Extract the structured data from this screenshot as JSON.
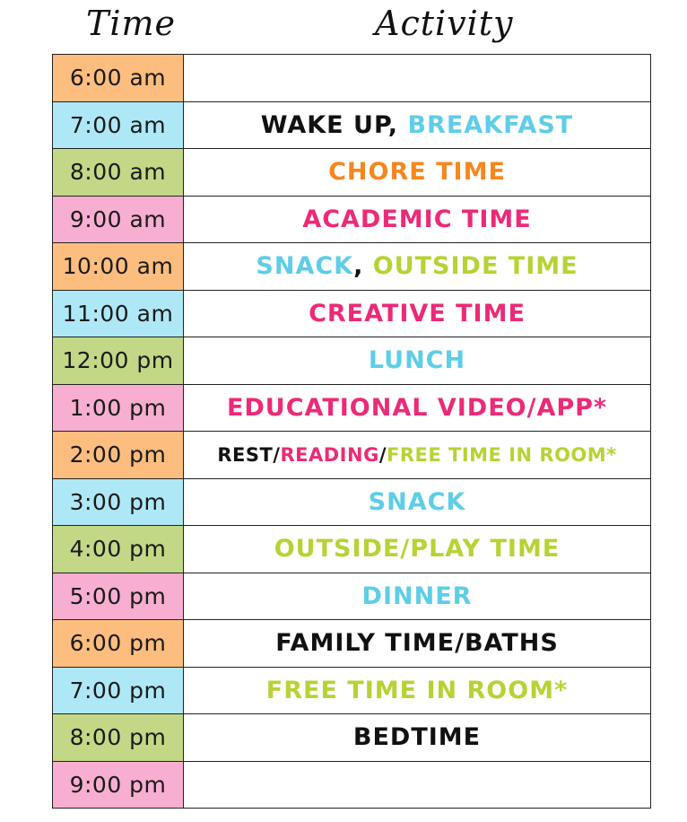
{
  "headers": {
    "time": "Time",
    "activity": "Activity"
  },
  "rows": [
    {
      "time": "6:00 am",
      "segments": []
    },
    {
      "time": "7:00 am",
      "segments": [
        {
          "text": "WAKE UP, ",
          "color": "#111111"
        },
        {
          "text": "BREAKFAST",
          "color": "#5ecde8"
        }
      ]
    },
    {
      "time": "8:00 am",
      "segments": [
        {
          "text": "CHORE TIME",
          "color": "#f6871f"
        }
      ]
    },
    {
      "time": "9:00 am",
      "segments": [
        {
          "text": "ACADEMIC TIME",
          "color": "#ec2a77"
        }
      ]
    },
    {
      "time": "10:00 am",
      "segments": [
        {
          "text": "SNACK",
          "color": "#5ecde8"
        },
        {
          "text": ", ",
          "color": "#111111"
        },
        {
          "text": "OUTSIDE TIME",
          "color": "#b5d334"
        }
      ]
    },
    {
      "time": "11:00 am",
      "segments": [
        {
          "text": "CREATIVE TIME",
          "color": "#ec2a77"
        }
      ]
    },
    {
      "time": "12:00 pm",
      "segments": [
        {
          "text": "LUNCH",
          "color": "#5ecde8"
        }
      ]
    },
    {
      "time": "1:00 pm",
      "segments": [
        {
          "text": "EDUCATIONAL VIDEO/APP*",
          "color": "#ec2a77"
        }
      ]
    },
    {
      "time": "2:00 pm",
      "small": true,
      "segments": [
        {
          "text": "REST/",
          "color": "#111111"
        },
        {
          "text": "READING",
          "color": "#ec2a77"
        },
        {
          "text": "/",
          "color": "#111111"
        },
        {
          "text": "FREE TIME IN ROOM*",
          "color": "#b5d334"
        }
      ]
    },
    {
      "time": "3:00 pm",
      "segments": [
        {
          "text": "SNACK",
          "color": "#5ecde8"
        }
      ]
    },
    {
      "time": "4:00 pm",
      "segments": [
        {
          "text": "OUTSIDE/PLAY TIME",
          "color": "#b5d334"
        }
      ]
    },
    {
      "time": "5:00 pm",
      "segments": [
        {
          "text": "DINNER",
          "color": "#5ecde8"
        }
      ]
    },
    {
      "time": "6:00 pm",
      "segments": [
        {
          "text": "FAMILY TIME/BATHS",
          "color": "#111111"
        }
      ]
    },
    {
      "time": "7:00 pm",
      "segments": [
        {
          "text": "FREE TIME IN ROOM*",
          "color": "#b5d334"
        }
      ]
    },
    {
      "time": "8:00 pm",
      "segments": [
        {
          "text": "BEDTIME",
          "color": "#111111"
        }
      ]
    },
    {
      "time": "9:00 pm",
      "segments": []
    }
  ],
  "time_cell_colors": [
    "orange",
    "blue",
    "green",
    "pink"
  ]
}
